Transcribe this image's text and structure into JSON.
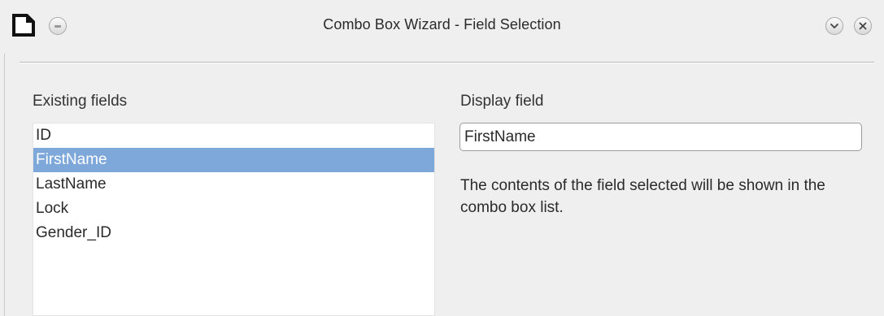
{
  "window": {
    "title": "Combo Box Wizard - Field Selection"
  },
  "icons": {
    "app": "document-icon",
    "menu": "window-menu-icon",
    "minimize": "chevron-down-icon",
    "close": "close-icon"
  },
  "existing_fields": {
    "label": "Existing fields",
    "items": [
      {
        "label": "ID",
        "selected": false
      },
      {
        "label": "FirstName",
        "selected": true
      },
      {
        "label": "LastName",
        "selected": false
      },
      {
        "label": "Lock",
        "selected": false
      },
      {
        "label": "Gender_ID",
        "selected": false
      }
    ]
  },
  "display_field": {
    "label": "Display field",
    "value": "FirstName"
  },
  "info": {
    "text": "The contents of the field selected will be shown in the combo box list."
  },
  "colors": {
    "selection": "#7fa8da",
    "background": "#efefef"
  }
}
